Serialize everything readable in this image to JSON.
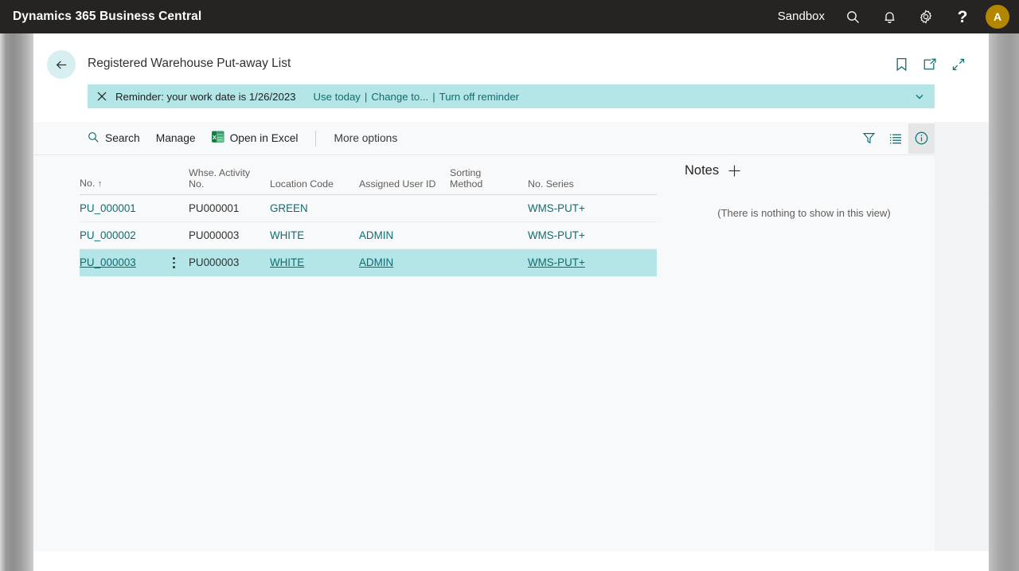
{
  "appbar": {
    "title": "Dynamics 365 Business Central",
    "environment": "Sandbox",
    "search_icon": "search-icon",
    "notifications_icon": "bell-icon",
    "settings_icon": "gear-icon",
    "help_label": "?",
    "avatar_initial": "A",
    "avatar_color": "#b38600",
    "background": "#252423"
  },
  "header": {
    "back_label": "Back",
    "page_title": "Registered Warehouse Put-away List",
    "icons": [
      "bookmark-icon",
      "open-in-new-window-icon",
      "collapse-icon"
    ],
    "accent_color": "#0f6d72"
  },
  "notification": {
    "message": "Reminder: your work date is 1/26/2023",
    "links": [
      "Use today",
      "Change to...",
      "Turn off reminder"
    ],
    "separator": "|",
    "background": "#b4e5e7",
    "close_icon": "close-icon",
    "expand_icon": "chevron-down-icon"
  },
  "toolbar": {
    "search_label": "Search",
    "manage_label": "Manage",
    "excel_label": "Open in Excel",
    "more_options_label": "More options",
    "right_icons": [
      "filter-icon",
      "list-view-icon",
      "info-icon"
    ],
    "active_icon": "info-icon"
  },
  "table": {
    "columns": [
      {
        "label": "No.",
        "sort": "↑"
      },
      {
        "label": "Whse. Activity",
        "label2": "No."
      },
      {
        "label": "Location Code"
      },
      {
        "label": "Assigned User ID"
      },
      {
        "label": "Sorting",
        "label2": "Method"
      },
      {
        "label": "No. Series"
      }
    ],
    "rows": [
      {
        "no": "PU_000001",
        "whse_activity_no": "PU000001",
        "location_code": "GREEN",
        "assigned_user_id": "",
        "sorting_method": "",
        "no_series": "WMS-PUT+",
        "selected": false
      },
      {
        "no": "PU_000002",
        "whse_activity_no": "PU000003",
        "location_code": "WHITE",
        "assigned_user_id": "ADMIN",
        "sorting_method": "",
        "no_series": "WMS-PUT+",
        "selected": false
      },
      {
        "no": "PU_000003",
        "whse_activity_no": "PU000003",
        "location_code": "WHITE",
        "assigned_user_id": "ADMIN",
        "sorting_method": "",
        "no_series": "WMS-PUT+",
        "selected": true
      }
    ],
    "selected_row_color": "#b4e5e7"
  },
  "notes": {
    "title": "Notes",
    "add_icon": "plus-icon",
    "empty_text": "(There is nothing to show in this view)"
  }
}
